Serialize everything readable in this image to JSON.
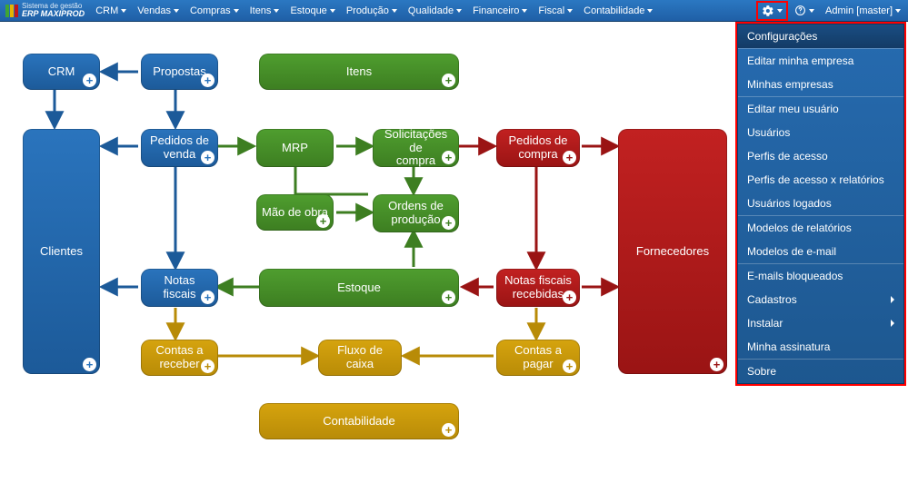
{
  "brand": {
    "top": "Sistema de gestão",
    "bottom": "ERP MAXIPROD"
  },
  "nav": {
    "items": [
      {
        "label": "CRM"
      },
      {
        "label": "Vendas"
      },
      {
        "label": "Compras"
      },
      {
        "label": "Itens"
      },
      {
        "label": "Estoque"
      },
      {
        "label": "Produção"
      },
      {
        "label": "Qualidade"
      },
      {
        "label": "Financeiro"
      },
      {
        "label": "Fiscal"
      },
      {
        "label": "Contabilidade"
      }
    ],
    "admin_label": "Admin [master]"
  },
  "dropdown": {
    "groups": [
      [
        {
          "label": "Configurações",
          "selected": true
        }
      ],
      [
        {
          "label": "Editar minha empresa"
        },
        {
          "label": "Minhas empresas"
        }
      ],
      [
        {
          "label": "Editar meu usuário"
        },
        {
          "label": "Usuários"
        },
        {
          "label": "Perfis de acesso"
        },
        {
          "label": "Perfis de acesso x relatórios"
        },
        {
          "label": "Usuários logados"
        }
      ],
      [
        {
          "label": "Modelos de relatórios"
        },
        {
          "label": "Modelos de e-mail"
        }
      ],
      [
        {
          "label": "E-mails bloqueados"
        },
        {
          "label": "Cadastros",
          "submenu": true
        },
        {
          "label": "Instalar",
          "submenu": true
        },
        {
          "label": "Minha assinatura"
        }
      ],
      [
        {
          "label": "Sobre"
        }
      ]
    ]
  },
  "nodes": {
    "crm": {
      "label": "CRM"
    },
    "propostas": {
      "label": "Propostas"
    },
    "itens": {
      "label": "Itens"
    },
    "clientes": {
      "label": "Clientes"
    },
    "pedidos_venda": {
      "label": "Pedidos de\nvenda"
    },
    "mrp": {
      "label": "MRP"
    },
    "solic_compra": {
      "label": "Solicitações de\ncompra"
    },
    "pedidos_compra": {
      "label": "Pedidos de\ncompra"
    },
    "fornecedores": {
      "label": "Fornecedores"
    },
    "mao_obra": {
      "label": "Mão de obra"
    },
    "ordens_prod": {
      "label": "Ordens de\nprodução"
    },
    "estoque": {
      "label": "Estoque"
    },
    "notas_fiscais": {
      "label": "Notas\nfiscais"
    },
    "nf_recebidas": {
      "label": "Notas fiscais\nrecebidas"
    },
    "contas_receber": {
      "label": "Contas a\nreceber"
    },
    "fluxo_caixa": {
      "label": "Fluxo de\ncaixa"
    },
    "contas_pagar": {
      "label": "Contas a\npagar"
    },
    "contabilidade": {
      "label": "Contabilidade"
    }
  },
  "colors": {
    "blue": "#1c5a99",
    "green": "#3d7e21",
    "red": "#9a1414",
    "yellow": "#b88b07",
    "highlight": "#ff0000"
  }
}
